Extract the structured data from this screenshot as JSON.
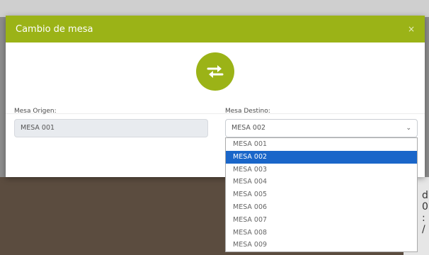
{
  "modal": {
    "title": "Cambio de mesa",
    "close_label": "×",
    "swap_icon": "swap-arrows-icon",
    "accent_color": "#9bb317"
  },
  "form": {
    "origin_label": "Mesa Origen:",
    "origin_value": "MESA 001",
    "destination_label": "Mesa Destino:",
    "destination_value": "MESA 002",
    "chevron": "⌄"
  },
  "dropdown": {
    "selected_index": 1,
    "options": [
      "MESA 001",
      "MESA 002",
      "MESA 003",
      "MESA 004",
      "MESA 005",
      "MESA 006",
      "MESA 007",
      "MESA 008",
      "MESA 009"
    ]
  },
  "background": {
    "right_text_line1": "d",
    "right_text_line2": "0",
    "right_text_line3": ": /"
  }
}
